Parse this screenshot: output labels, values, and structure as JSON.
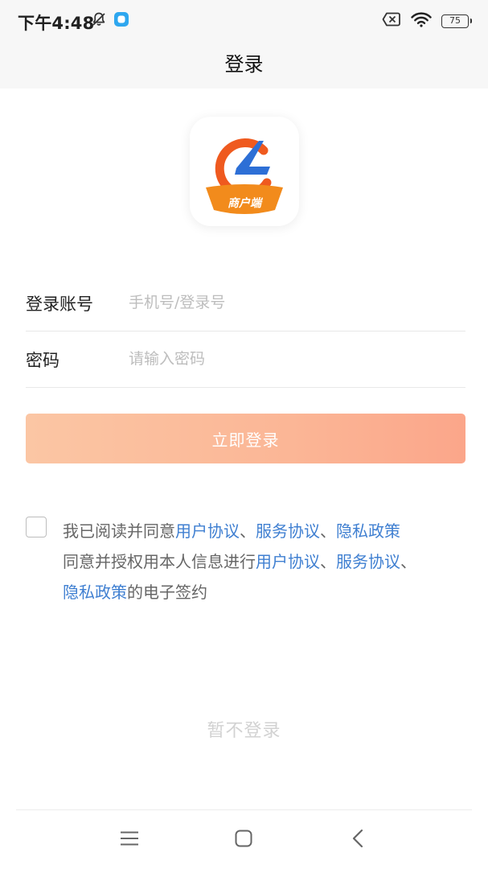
{
  "status_bar": {
    "time": "下午4:48",
    "battery": "75"
  },
  "header": {
    "title": "登录"
  },
  "logo": {
    "caption": "商户端",
    "colors": {
      "orange": "#ef5a1f",
      "blue": "#2d6fd6",
      "ribbon": "#f28b1c"
    }
  },
  "form": {
    "account_label": "登录账号",
    "account_placeholder": "手机号/登录号",
    "password_label": "密码",
    "password_placeholder": "请输入密码"
  },
  "login_button": {
    "label": "立即登录"
  },
  "agreement": {
    "checked": false,
    "prefix": "我已阅读并同意",
    "link_user": "用户协议",
    "sep": "、",
    "link_service": "服务协议",
    "link_privacy": "隐私政策",
    "middle": "同意并授权用本人信息进行",
    "suffix": "的电子签约"
  },
  "skip_login": {
    "label": "暂不登录"
  },
  "colors": {
    "link": "#3f7fd1",
    "button_gradient_start": "#fbc6a4",
    "button_gradient_end": "#fba68a"
  }
}
